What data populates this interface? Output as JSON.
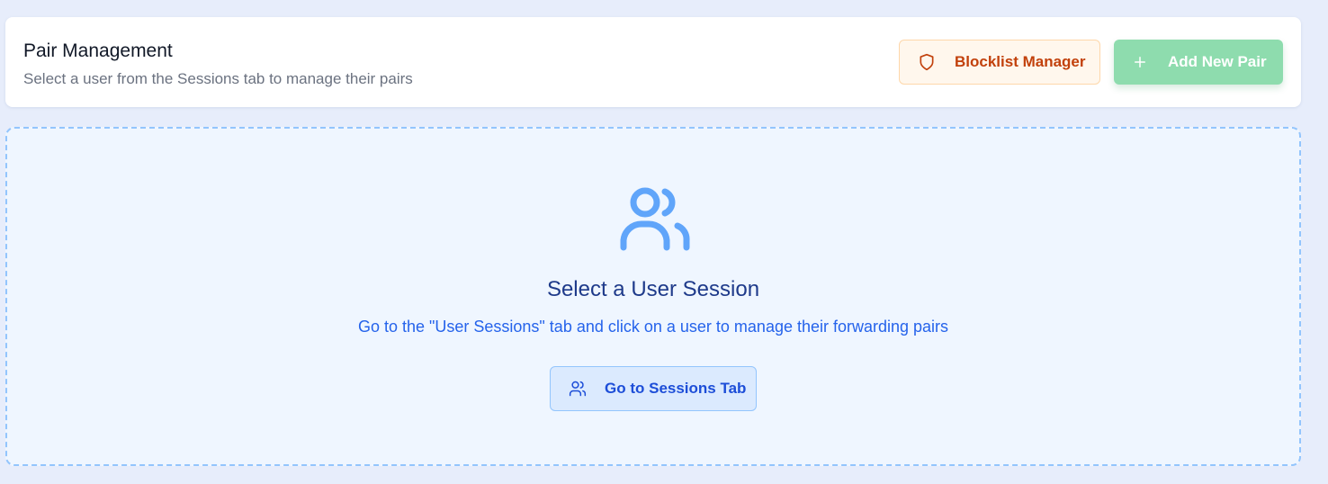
{
  "header": {
    "title": "Pair Management",
    "subtitle": "Select a user from the Sessions tab to manage their pairs",
    "blocklist_button": {
      "label": "Blocklist Manager",
      "icon": "shield-icon"
    },
    "add_pair_button": {
      "label": "Add New Pair",
      "icon": "plus-icon",
      "disabled": true
    }
  },
  "empty_state": {
    "icon": "users-icon",
    "title": "Select a User Session",
    "description": "Go to the \"User Sessions\" tab and click on a user to manage their forwarding pairs",
    "button": {
      "label": "Go to Sessions Tab",
      "icon": "users-icon"
    }
  },
  "colors": {
    "page_bg": "#e7edfb",
    "blocklist_accent": "#c2410c",
    "add_pair_bg": "#8edcae",
    "empty_accent": "#2563eb",
    "empty_title": "#1e3a8a"
  }
}
